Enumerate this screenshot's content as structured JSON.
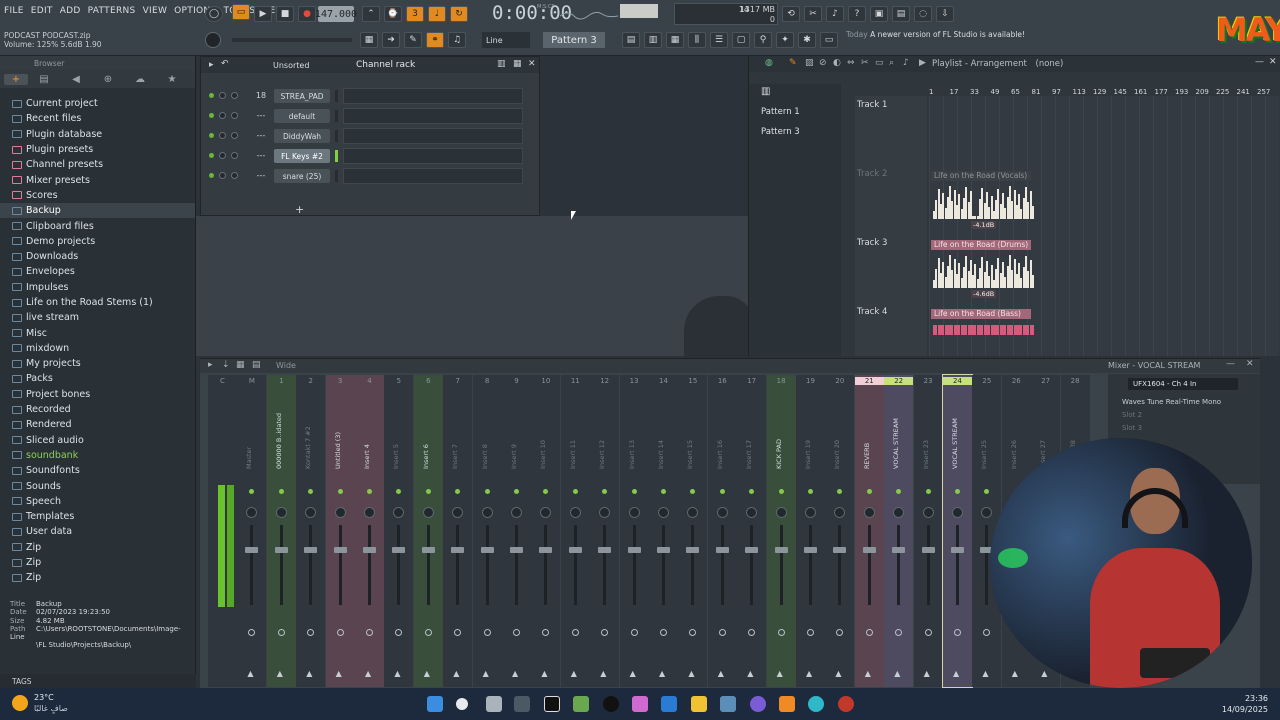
{
  "menu": [
    "FILE",
    "EDIT",
    "ADD",
    "PATTERNS",
    "VIEW",
    "OPTIONS",
    "TOOLS",
    "HELP"
  ],
  "project": {
    "filename": "PODCAST PODCAST.zip",
    "volume_hint": "Volume: 125%  5.6dB  1.90"
  },
  "transport": {
    "tempo": "147.000",
    "time": "0:00:00",
    "time_label": "M:S:CS",
    "cpu_a": "14",
    "cpu_b": "1317 MB",
    "cpu_c": "",
    "cpu_d": "0"
  },
  "toolbar": {
    "snap": "Line",
    "pattern": "Pattern 3"
  },
  "news": {
    "label": "Today",
    "text": "A newer version of FL Studio is available!"
  },
  "logo": {
    "text": "MAY"
  },
  "browser": {
    "title": "Browser",
    "items": [
      {
        "label": "Current project",
        "color": "#6a88a0"
      },
      {
        "label": "Recent files",
        "color": "#6a88a0"
      },
      {
        "label": "Plugin database",
        "color": "#6a88a0"
      },
      {
        "label": "Plugin presets",
        "color": "#e47a9a"
      },
      {
        "label": "Channel presets",
        "color": "#e47a9a"
      },
      {
        "label": "Mixer presets",
        "color": "#e47a9a"
      },
      {
        "label": "Scores",
        "color": "#e47a9a"
      },
      {
        "label": "Backup",
        "color": "#6a88a0",
        "selected": true
      },
      {
        "label": "Clipboard files",
        "color": "#6a88a0"
      },
      {
        "label": "Demo projects",
        "color": "#6a88a0"
      },
      {
        "label": "Downloads",
        "color": "#6a88a0"
      },
      {
        "label": "Envelopes",
        "color": "#6a88a0"
      },
      {
        "label": "Impulses",
        "color": "#6a88a0"
      },
      {
        "label": "Life on the Road Stems (1)",
        "color": "#6a88a0"
      },
      {
        "label": "live stream",
        "color": "#6a88a0"
      },
      {
        "label": "Misc",
        "color": "#6a88a0"
      },
      {
        "label": "mixdown",
        "color": "#6a88a0"
      },
      {
        "label": "My projects",
        "color": "#6a88a0"
      },
      {
        "label": "Packs",
        "color": "#6a88a0"
      },
      {
        "label": "Project bones",
        "color": "#6a88a0"
      },
      {
        "label": "Recorded",
        "color": "#6a88a0"
      },
      {
        "label": "Rendered",
        "color": "#6a88a0"
      },
      {
        "label": "Sliced audio",
        "color": "#6a88a0"
      },
      {
        "label": "soundbank",
        "color": "#6a88a0",
        "green": true
      },
      {
        "label": "Soundfonts",
        "color": "#6a88a0"
      },
      {
        "label": "Sounds",
        "color": "#6a88a0"
      },
      {
        "label": "Speech",
        "color": "#6a88a0"
      },
      {
        "label": "Templates",
        "color": "#6a88a0"
      },
      {
        "label": "User data",
        "color": "#6a88a0"
      },
      {
        "label": "Zip",
        "color": "#6a88a0"
      },
      {
        "label": "Zip",
        "color": "#6a88a0"
      },
      {
        "label": "Zip",
        "color": "#6a88a0"
      }
    ],
    "info": {
      "title_k": "Title",
      "title_v": "Backup",
      "date_k": "Date",
      "date_v": "02/07/2023 19:23:50",
      "size_k": "Size",
      "size_v": "4.82 MB",
      "path_k": "Path",
      "path_v1": "C:\\Users\\ROOTSTONE\\Documents\\Image-Line",
      "path_v2": "\\FL Studio\\Projects\\Backup\\"
    },
    "tags": "TAGS"
  },
  "channel_rack": {
    "filter": "Unsorted",
    "title": "Channel rack",
    "channels": [
      {
        "num": "18",
        "name": "STREA_PAD",
        "selected": false,
        "led": false
      },
      {
        "num": "---",
        "name": "default",
        "selected": false,
        "led": false
      },
      {
        "num": "---",
        "name": "DiddyWah",
        "selected": false,
        "led": false
      },
      {
        "num": "---",
        "name": "FL Keys #2",
        "selected": true,
        "led": true
      },
      {
        "num": "---",
        "name": "snare (25)",
        "selected": false,
        "led": false
      }
    ],
    "add": "+"
  },
  "playlist": {
    "title": "Playlist - Arrangement",
    "title_sub": "(none)",
    "patterns": [
      "Pattern 1",
      "Pattern 3"
    ],
    "ruler": [
      "1",
      "17",
      "33",
      "49",
      "65",
      "81",
      "97",
      "113",
      "129",
      "145",
      "161",
      "177",
      "193",
      "209",
      "225",
      "241",
      "257"
    ],
    "tracks": [
      {
        "label": "Track 1",
        "dim": false
      },
      {
        "label": "Track 2",
        "dim": true
      },
      {
        "label": "Track 3",
        "dim": false
      },
      {
        "label": "Track 4",
        "dim": false
      }
    ],
    "clips": [
      {
        "title": "Life on the Road (Vocals)",
        "db": "-4.1dB",
        "kind": "vocal"
      },
      {
        "title": "Life on the Road (Drums)",
        "db": "-4.6dB",
        "kind": "drum"
      },
      {
        "title": "Life on the Road (Bass)",
        "db": "",
        "kind": "bass"
      }
    ]
  },
  "mixer": {
    "view": "Wide",
    "title": "Mixer - VOCAL STREAM",
    "input": "UFX1604 - Ch 4 In",
    "slots": [
      {
        "label": "Waves Tune Real-Time Mono",
        "dim": false
      },
      {
        "label": "Slot 2",
        "dim": true
      },
      {
        "label": "Slot 3",
        "dim": true
      }
    ],
    "strips": [
      {
        "num": "C",
        "name": "",
        "tint": "none"
      },
      {
        "num": "M",
        "name": "Master",
        "tint": "none"
      },
      {
        "num": "1",
        "name": "000000 B..idated",
        "tint": "green"
      },
      {
        "num": "2",
        "name": "Kontakt 7 #2",
        "tint": "none"
      },
      {
        "num": "3",
        "name": "Untitled (3)",
        "tint": "pink"
      },
      {
        "num": "4",
        "name": "Insert 4",
        "tint": "pink"
      },
      {
        "num": "5",
        "name": "Insert 5",
        "tint": "none"
      },
      {
        "num": "6",
        "name": "Insert 6",
        "tint": "green"
      },
      {
        "num": "7",
        "name": "Insert 7",
        "tint": "none"
      },
      {
        "num": "8",
        "name": "Insert 8",
        "tint": "none"
      },
      {
        "num": "9",
        "name": "Insert 9",
        "tint": "none"
      },
      {
        "num": "10",
        "name": "Insert 10",
        "tint": "none"
      },
      {
        "num": "11",
        "name": "Insert 11",
        "tint": "none"
      },
      {
        "num": "12",
        "name": "Insert 12",
        "tint": "none"
      },
      {
        "num": "13",
        "name": "Insert 13",
        "tint": "none"
      },
      {
        "num": "14",
        "name": "Insert 14",
        "tint": "none"
      },
      {
        "num": "15",
        "name": "Insert 15",
        "tint": "none"
      },
      {
        "num": "16",
        "name": "Insert 16",
        "tint": "none"
      },
      {
        "num": "17",
        "name": "Insert 17",
        "tint": "none"
      },
      {
        "num": "18",
        "name": "KICK PAD",
        "tint": "green"
      },
      {
        "num": "19",
        "name": "Insert 19",
        "tint": "none"
      },
      {
        "num": "20",
        "name": "Insert 20",
        "tint": "none"
      },
      {
        "num": "21",
        "name": "REVERB",
        "tint": "pink"
      },
      {
        "num": "22",
        "name": "VOCAL STREAM",
        "tint": "purple"
      },
      {
        "num": "23",
        "name": "Insert 23",
        "tint": "none"
      },
      {
        "num": "24",
        "name": "VOCAL STREAM",
        "tint": "purple"
      },
      {
        "num": "25",
        "name": "Insert 25",
        "tint": "none"
      },
      {
        "num": "26",
        "name": "Insert 26",
        "tint": "none"
      },
      {
        "num": "27",
        "name": "Insert 27",
        "tint": "none"
      },
      {
        "num": "28",
        "name": "Insert 28",
        "tint": "none"
      }
    ]
  },
  "taskbar": {
    "temp": "23°C",
    "desc": "صافٍ غالبًا",
    "time": "23:36",
    "date": "14/09/2025"
  }
}
